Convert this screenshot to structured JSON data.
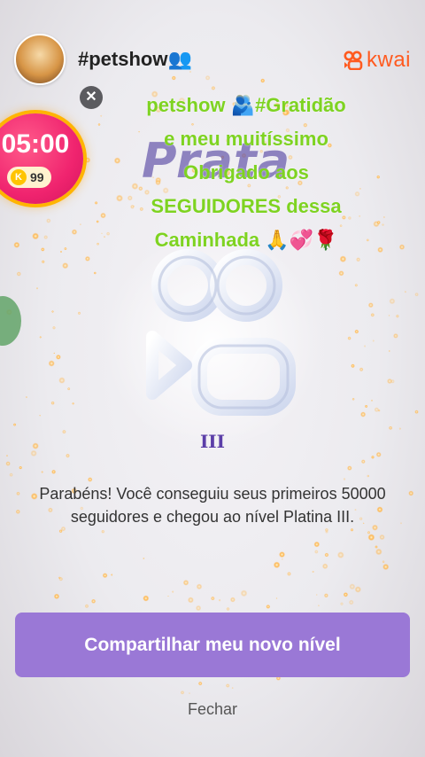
{
  "header": {
    "handle": "#petshow",
    "handle_icon": "👥",
    "brand_name": "kwai",
    "brand_color": "#ff5a1f"
  },
  "live_timer": {
    "time": "05:00",
    "coin_label": "K",
    "coins": "99"
  },
  "caption": {
    "lines": [
      "petshow 🫂#Gratidão",
      "e meu muitíssimo",
      "Obrigado aos",
      "SEGUIDORES dessa",
      "Caminhada 🙏💞🌹"
    ],
    "color": "#7ed321"
  },
  "level": {
    "word": "Prata",
    "tier": "III"
  },
  "message": {
    "line1": "Parabéns! Você conseguiu seus primeiros 50000",
    "line2": "seguidores e chegou ao nível Platina III."
  },
  "actions": {
    "share_label": "Compartilhar meu novo nível",
    "close_label": "Fechar"
  },
  "colors": {
    "accent": "#9a78d6",
    "timer_bg": "#f0246f"
  }
}
